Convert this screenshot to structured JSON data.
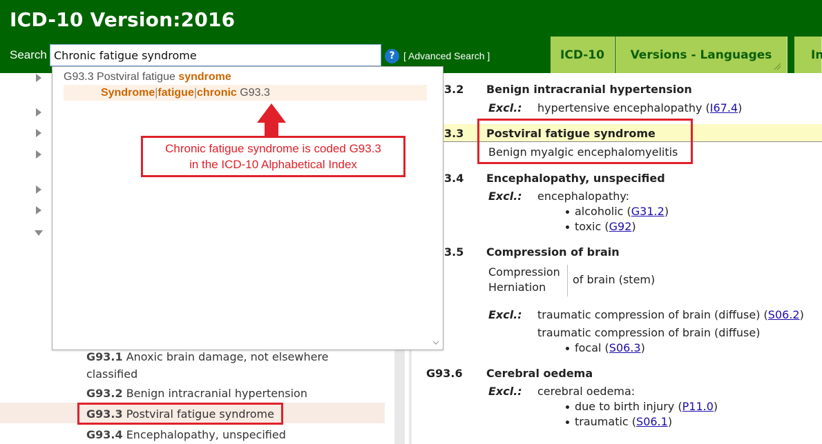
{
  "header": {
    "title": "ICD-10 Version:2016",
    "search_label": "Search",
    "search_value": "Chronic fatigue syndrome",
    "help_icon": "?",
    "advanced_search": "[ Advanced Search ]"
  },
  "tabs": [
    {
      "label": "ICD-10"
    },
    {
      "label": "Versions - Languages"
    },
    {
      "label": "In"
    }
  ],
  "dropdown": {
    "row1": {
      "prefix": "G93.3 Postviral fatigue ",
      "highlight": "syndrome"
    },
    "row2": {
      "w1": "Syndrome",
      "sep": "|",
      "w2": "fatigue",
      "w3": "chronic",
      "code": " G93.3"
    }
  },
  "callout": {
    "line1": "Chronic fatigue syndrome is coded G93.3",
    "line2": "in the ICD-10 Alphabetical Index"
  },
  "left_tree": [
    {
      "code": "G93.1",
      "text": " Anoxic brain damage, not elsewhere"
    },
    {
      "code": "",
      "text": "classified"
    },
    {
      "code": "G93.2",
      "text": " Benign intracranial hypertension"
    },
    {
      "code": "G93.3",
      "text": " Postviral fatigue syndrome"
    },
    {
      "code": "G93.4",
      "text": " Encephalopathy, unspecified"
    }
  ],
  "right": {
    "g932": {
      "code": "3.2",
      "title": "Benign intracranial hypertension",
      "excl_label": "Excl.:",
      "excl_text": "hypertensive encephalopathy (",
      "link": "I67.4",
      "close": ")"
    },
    "g933": {
      "code": "3.3",
      "title": "Postviral fatigue syndrome",
      "incl": "Benign myalgic encephalomyelitis"
    },
    "g934": {
      "code": "3.4",
      "title": "Encephalopathy, unspecified",
      "excl_label": "Excl.:",
      "excl_text": "encephalopathy:",
      "b1_text": "alcoholic (",
      "b1_link": "G31.2",
      "b2_text": "toxic (",
      "b2_link": "G92",
      "close": ")"
    },
    "g935": {
      "code": "3.5",
      "title": "Compression of brain",
      "t1": "Compression",
      "t2": "Herniation",
      "t3": "of brain (stem)",
      "excl_label": "Excl.:",
      "e1_text": "traumatic compression of brain (diffuse) (",
      "e1_link": "S06.2",
      "e2_text": "traumatic compression of brain (diffuse)",
      "b_text": "focal (",
      "b_link": "S06.3",
      "close": ")"
    },
    "g936": {
      "code": "G93.6",
      "title": "Cerebral oedema",
      "excl_label": "Excl.:",
      "excl_text": "cerebral oedema:",
      "b1_text": "due to birth injury (",
      "b1_link": "P11.0",
      "b2_text": "traumatic (",
      "b2_link": "S06.1",
      "close": ")"
    }
  }
}
